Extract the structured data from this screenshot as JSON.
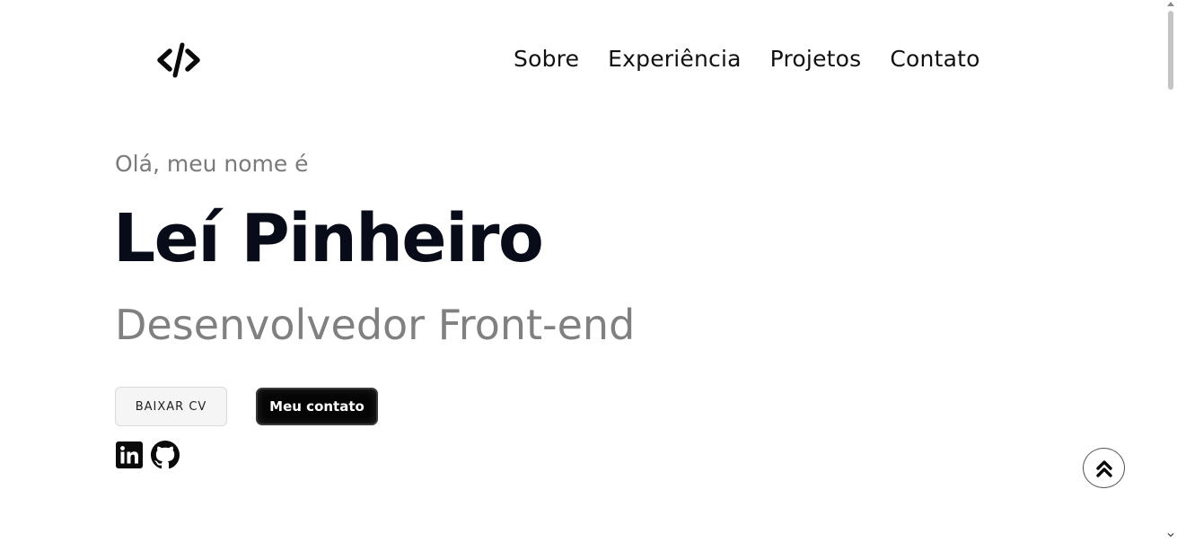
{
  "header": {
    "logo_icon": "code-brackets-icon",
    "nav": [
      {
        "label": "Sobre"
      },
      {
        "label": "Experiência"
      },
      {
        "label": "Projetos"
      },
      {
        "label": "Contato"
      }
    ]
  },
  "hero": {
    "greeting": "Olá, meu nome é",
    "name": "Leí Pinheiro",
    "role": "Desenvolvedor Front-end",
    "buttons": {
      "cv_label": "BAIXAR CV",
      "contact_label": "Meu contato"
    },
    "social": [
      {
        "icon": "linkedin-icon"
      },
      {
        "icon": "github-icon"
      }
    ]
  },
  "back_to_top": {
    "icon": "double-chevron-up-icon"
  },
  "colors": {
    "text_dark": "#080b18",
    "text_muted": "#7a7a7a",
    "button_dark": "#050505",
    "button_light": "#f5f5f5"
  }
}
